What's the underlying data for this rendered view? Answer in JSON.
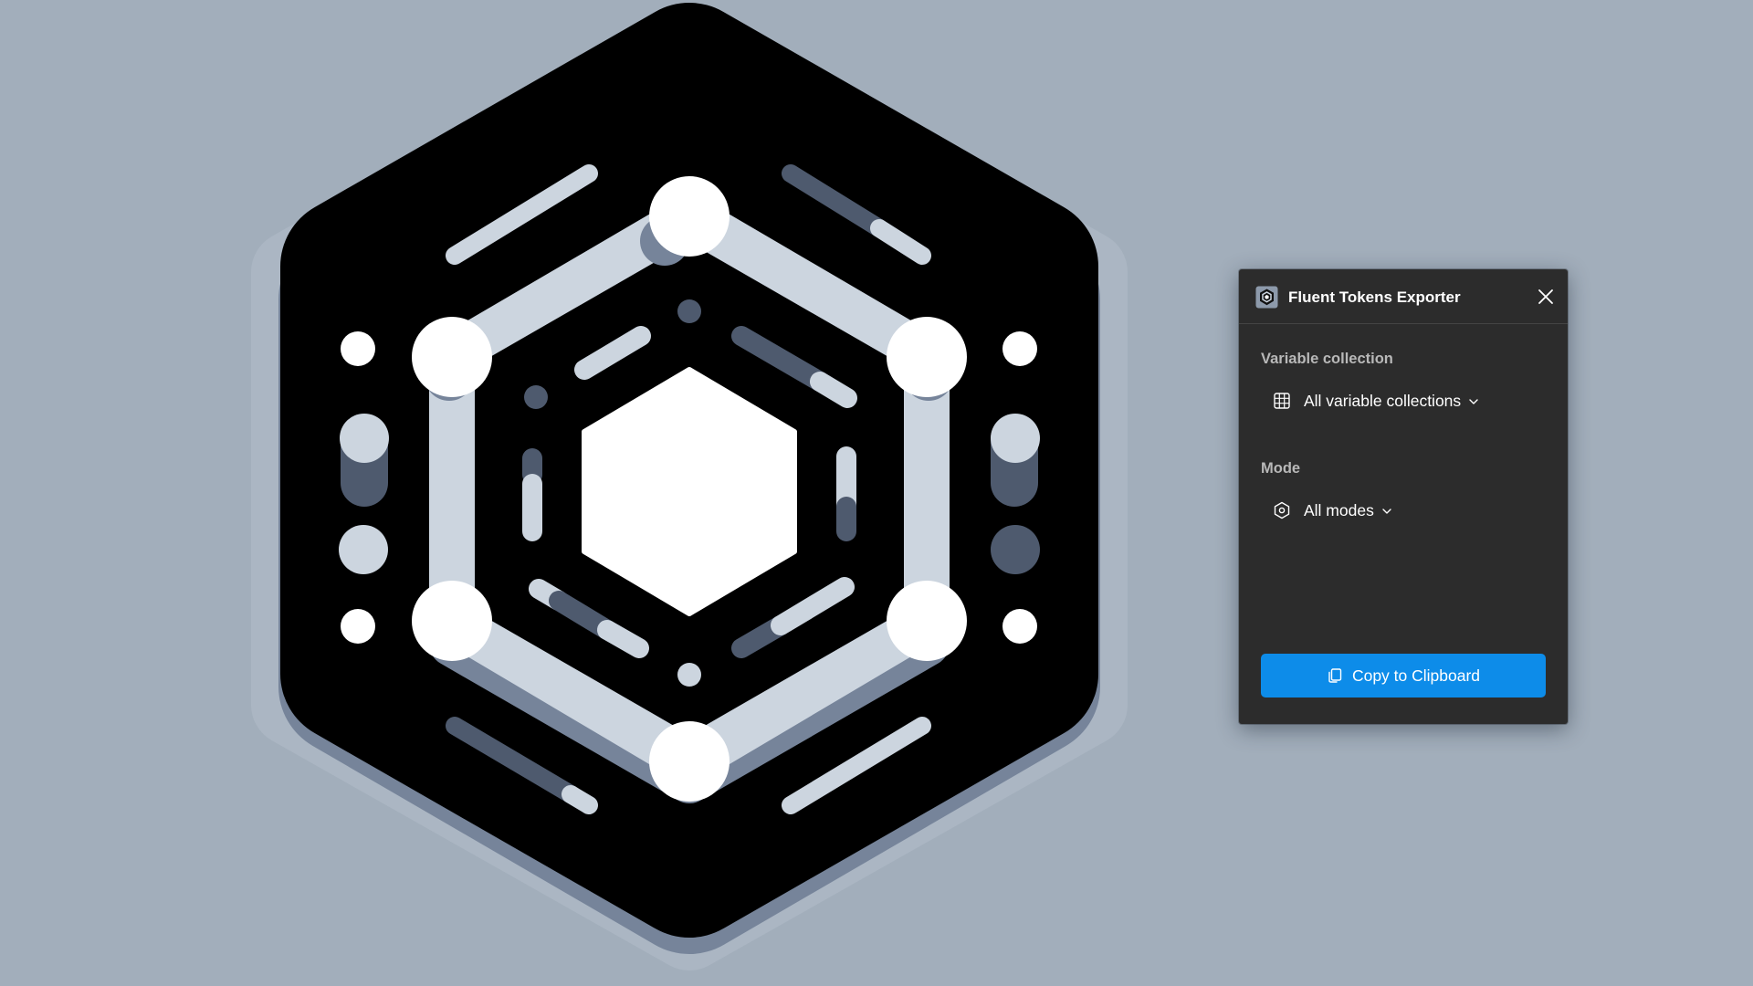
{
  "colors": {
    "canvas_background": "#a2aebb",
    "panel_background": "#2c2c2c",
    "accent": "#0d8ce9",
    "logo_dark": "#000000",
    "logo_light": "#ffffff",
    "logo_pale": "#ccd5df",
    "logo_slate": "#4e5a6e"
  },
  "plugin": {
    "title": "Fluent Tokens Exporter",
    "icon": "hexagon-logo-icon",
    "close_icon": "close-icon"
  },
  "variable_collection": {
    "label": "Variable collection",
    "selected": "All variable collections",
    "icon": "table-grid-icon"
  },
  "mode": {
    "label": "Mode",
    "selected": "All modes",
    "icon": "hexagon-mode-icon"
  },
  "copy_button": {
    "label": "Copy to Clipboard",
    "icon": "copy-icon"
  }
}
